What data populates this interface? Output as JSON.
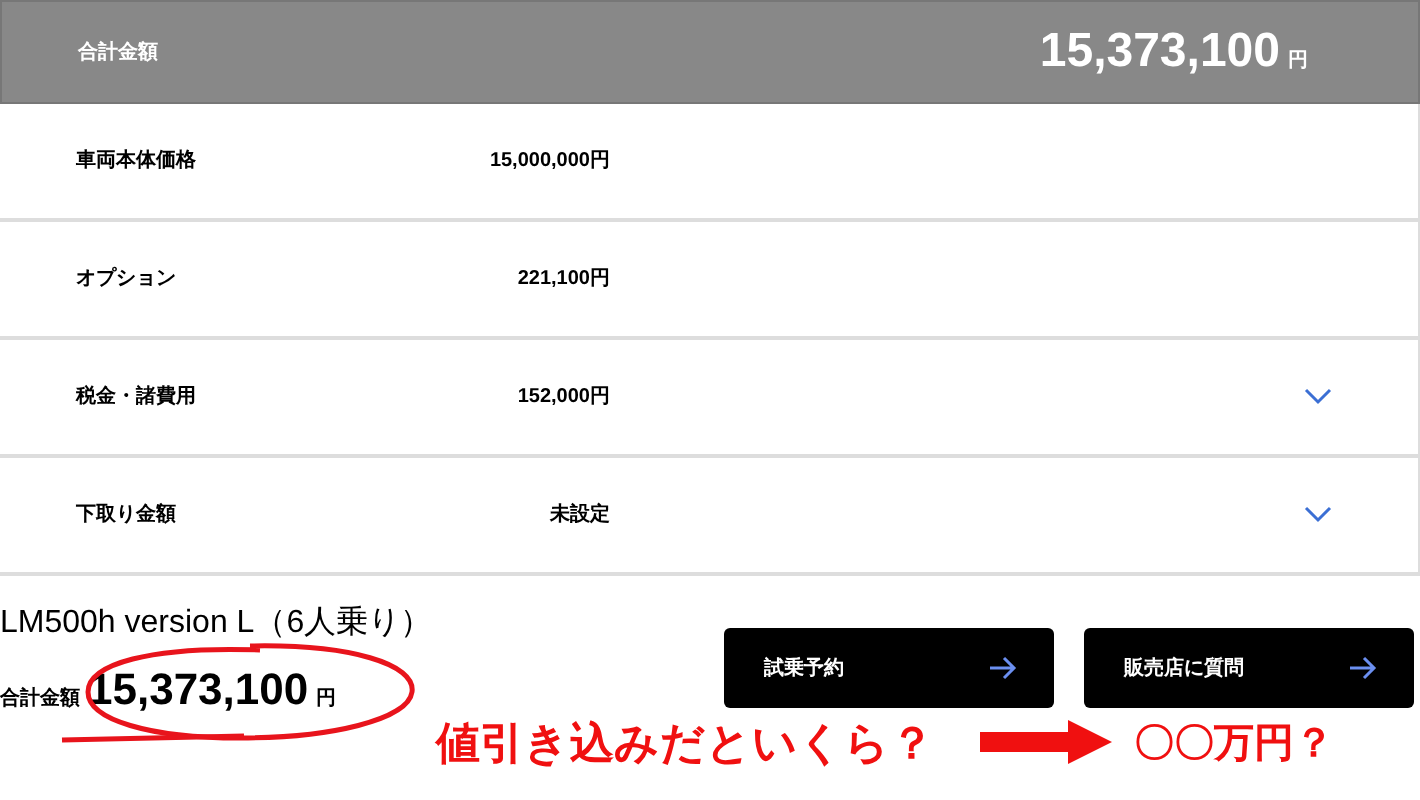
{
  "total_bar": {
    "label": "合計金額",
    "amount": "15,373,100",
    "unit": "円"
  },
  "rows": [
    {
      "label": "車両本体価格",
      "value": "15,000,000円",
      "expandable": false
    },
    {
      "label": "オプション",
      "value": "221,100円",
      "expandable": false
    },
    {
      "label": "税金・諸費用",
      "value": "152,000円",
      "expandable": true
    },
    {
      "label": "下取り金額",
      "value": "未設定",
      "expandable": true
    }
  ],
  "summary": {
    "model": "LM500h version L（6人乗り）",
    "total_label": "合計金額",
    "total": "15,373,100",
    "unit": "円"
  },
  "buttons": [
    {
      "label": "試乗予約"
    },
    {
      "label": "販売店に質問"
    }
  ],
  "annotations": {
    "question": "値引き込みだといくら？",
    "answer": "〇〇万円？"
  }
}
